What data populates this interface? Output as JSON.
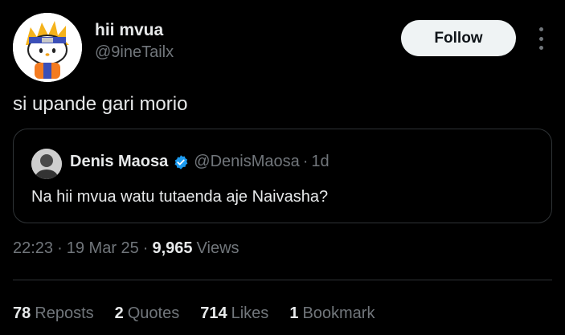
{
  "author": {
    "display_name": "hii mvua",
    "handle": "@9ineTailx"
  },
  "follow_label": "Follow",
  "tweet_text": "si upande gari morio",
  "quote": {
    "display_name": "Denis Maosa",
    "handle": "@DenisMaosa",
    "separator": "·",
    "time": "1d",
    "text": "Na hii mvua watu tutaenda aje Naivasha?"
  },
  "meta": {
    "time": "22:23",
    "date": "19 Mar 25",
    "views_count": "9,965",
    "views_label": "Views",
    "separator": "·"
  },
  "stats": [
    {
      "count": "78",
      "label": "Reposts"
    },
    {
      "count": "2",
      "label": "Quotes"
    },
    {
      "count": "714",
      "label": "Likes"
    },
    {
      "count": "1",
      "label": "Bookmark"
    }
  ],
  "colors": {
    "background": "#000000",
    "text_primary": "#e7e9ea",
    "text_secondary": "#71767b",
    "border": "#2f3336",
    "verified_blue": "#1d9bf0"
  }
}
